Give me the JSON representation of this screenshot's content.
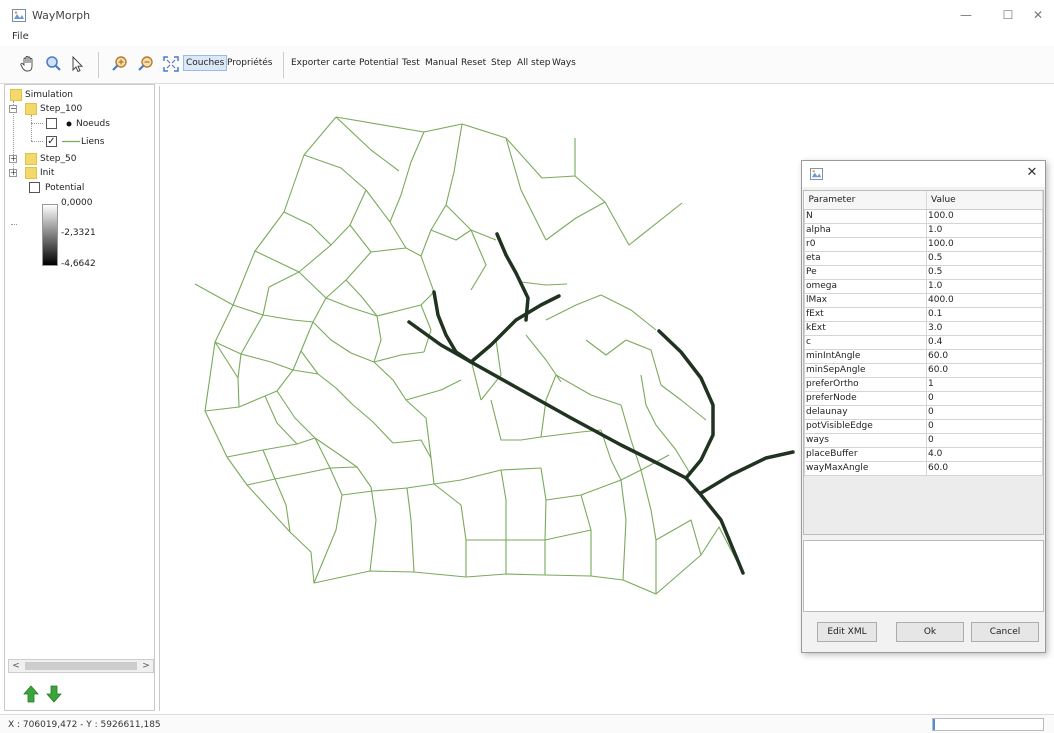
{
  "window": {
    "title": "WayMorph",
    "minimize_glyph": "—",
    "maximize_glyph": "☐",
    "close_glyph": "✕"
  },
  "menubar": {
    "file": "File"
  },
  "toolbar": {
    "icons": [
      "hand-pan-icon",
      "magnifier-icon",
      "arrow-select-icon",
      "zoom-in-icon",
      "zoom-out-icon",
      "fit-extent-icon"
    ],
    "couches": "Couches",
    "proprietes": "Propriétés",
    "exporter_carte": "Exporter carte",
    "potential": "Potential",
    "test": "Test",
    "manual": "Manual",
    "reset": "Reset",
    "step": "Step",
    "all_step": "All step",
    "ways": "Ways"
  },
  "tree": {
    "root": "Simulation",
    "step100": "Step_100",
    "noeuds": "Noeuds",
    "noeuds_checked": false,
    "liens": "Liens",
    "liens_checked": true,
    "step50": "Step_50",
    "init": "Init",
    "potential": "Potential",
    "potential_checked": false,
    "expander_collapse": "−",
    "expander_expand": "+",
    "check_mark": "✓",
    "legend_values": [
      "0,0000",
      "-2,3321",
      "-4,6642"
    ]
  },
  "scrollbar": {
    "left_arrow": "<",
    "right_arrow": ">"
  },
  "status": {
    "coords": "X : 706019,472 - Y : 5926611,185",
    "progress": 0.02
  },
  "colors": {
    "network_edges": "#7aaa5c",
    "main_ways": "#1f3320",
    "accent": "#4a8fd8"
  },
  "dialog": {
    "close_glyph": "✕",
    "col_parameter": "Parameter",
    "col_value": "Value",
    "params": [
      {
        "name": "N",
        "value": "100.0"
      },
      {
        "name": "alpha",
        "value": "1.0"
      },
      {
        "name": "r0",
        "value": "100.0"
      },
      {
        "name": "eta",
        "value": "0.5"
      },
      {
        "name": "Pe",
        "value": "0.5"
      },
      {
        "name": "omega",
        "value": "1.0"
      },
      {
        "name": "lMax",
        "value": "400.0"
      },
      {
        "name": "fExt",
        "value": "0.1"
      },
      {
        "name": "kExt",
        "value": "3.0"
      },
      {
        "name": "c",
        "value": "0.4"
      },
      {
        "name": "minIntAngle",
        "value": "60.0"
      },
      {
        "name": "minSepAngle",
        "value": "60.0"
      },
      {
        "name": "preferOrtho",
        "value": "1"
      },
      {
        "name": "preferNode",
        "value": "0"
      },
      {
        "name": "delaunay",
        "value": "0"
      },
      {
        "name": "potVisibleEdge",
        "value": "0"
      },
      {
        "name": "ways",
        "value": "0"
      },
      {
        "name": "placeBuffer",
        "value": "4.0"
      },
      {
        "name": "wayMaxAngle",
        "value": "60.0"
      }
    ],
    "edit_xml": "Edit XML",
    "ok": "Ok",
    "cancel": "Cancel"
  }
}
